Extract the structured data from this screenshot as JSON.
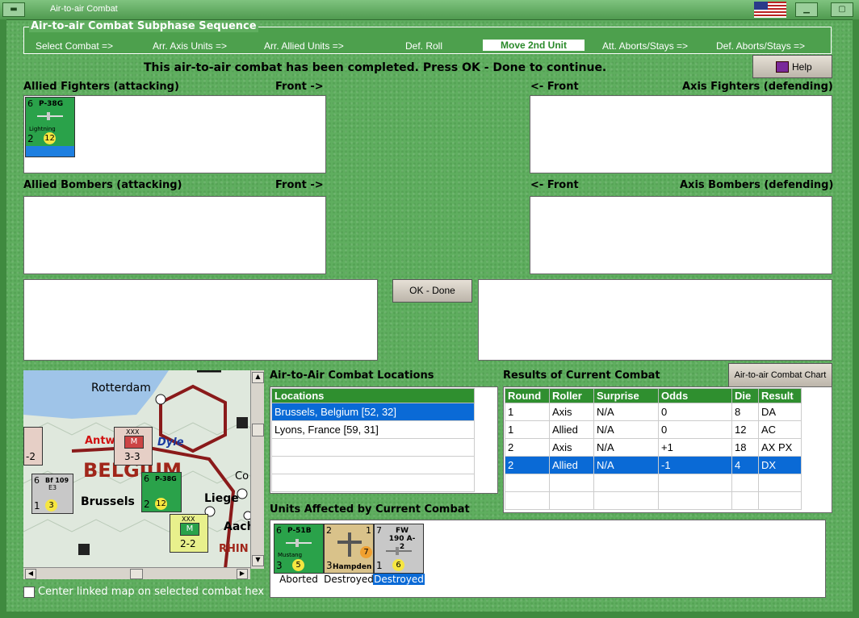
{
  "window": {
    "title": "Air-to-air Combat"
  },
  "phases": {
    "legend": "Air-to-air Combat Subphase Sequence",
    "items": [
      {
        "label": "Select Combat =>",
        "active": false
      },
      {
        "label": "Arr. Axis Units =>",
        "active": false
      },
      {
        "label": "Arr. Allied Units =>",
        "active": false
      },
      {
        "label": "Def. Roll",
        "active": false
      },
      {
        "label": "Move 2nd Unit",
        "active": true
      },
      {
        "label": "Att. Aborts/Stays =>",
        "active": false
      },
      {
        "label": "Def. Aborts/Stays =>",
        "active": false
      }
    ]
  },
  "message": "This air-to-air combat has been completed.  Press OK - Done to continue.",
  "help_label": "Help",
  "sections": {
    "allied_fighters": "Allied Fighters (attacking)",
    "allied_fighters_front": "Front ->",
    "axis_fighters_front": "<- Front",
    "axis_fighters": "Axis Fighters (defending)",
    "allied_bombers": "Allied Bombers (attacking)",
    "allied_bombers_front": "Front ->",
    "axis_bombers_front": "<- Front",
    "axis_bombers": "Axis Bombers (defending)"
  },
  "allied_fighter_counter": {
    "top": "6",
    "name": "P-38G",
    "sub": "Lightning",
    "num": "2",
    "circle": "12"
  },
  "ok_label": "OK - Done",
  "map": {
    "labels": {
      "rotterdam": "Rotterdam",
      "belgium": "BELGIUM",
      "brussels": "Brussels",
      "liege": "Liege",
      "antw": "Antw",
      "dyle": "Dyle",
      "aach": "Aach",
      "rhin": "RHIN",
      "co": "Co"
    },
    "counters": {
      "xxx1": "XXX",
      "m1": "M",
      "s1": "3-3",
      "bf": "Bf 109",
      "bf_sub": "E3",
      "bf_top": "6",
      "bf_num": "1",
      "bf_circle": "3",
      "p38": "P-38G",
      "p38_top": "6",
      "p38_num": "2",
      "p38_circle": "12",
      "xxx2": "XXX",
      "m2": "M",
      "s2": "2-2",
      "left_s": "-2"
    }
  },
  "center_map_label": "Center linked map on selected combat hex",
  "locations": {
    "title": "Air-to-Air Combat Locations",
    "header": "Locations",
    "rows": [
      "Brussels, Belgium [52, 32]",
      "Lyons, France [59, 31]"
    ],
    "selected": 0
  },
  "results": {
    "title": "Results of Current Combat",
    "chart_button": "Air-to-air Combat Chart",
    "headers": [
      "Round",
      "Roller",
      "Surprise",
      "Odds",
      "Die",
      "Result"
    ],
    "rows": [
      [
        "1",
        "Axis",
        "N/A",
        "0",
        "8",
        "DA"
      ],
      [
        "1",
        "Allied",
        "N/A",
        "0",
        "12",
        "AC"
      ],
      [
        "2",
        "Axis",
        "N/A",
        "+1",
        "18",
        "AX PX"
      ],
      [
        "2",
        "Allied",
        "N/A",
        "-1",
        "4",
        "DX"
      ]
    ],
    "selected": 3
  },
  "units_affected": {
    "title": "Units Affected by Current Combat",
    "units": [
      {
        "top": "6",
        "name": "P-51B",
        "sub": "Mustang",
        "num": "3",
        "circle": "5",
        "caption": "Aborted",
        "color": "green"
      },
      {
        "top": "2",
        "name": "",
        "sub": "Hampden",
        "num": "3",
        "circle": "7",
        "side": "1",
        "caption": "Destroyed",
        "color": "tan"
      },
      {
        "top": "7",
        "name": "FW 190 A-2",
        "sub": "",
        "num": "1",
        "circle": "6",
        "caption": "Destroyed",
        "color": "grey"
      }
    ]
  }
}
